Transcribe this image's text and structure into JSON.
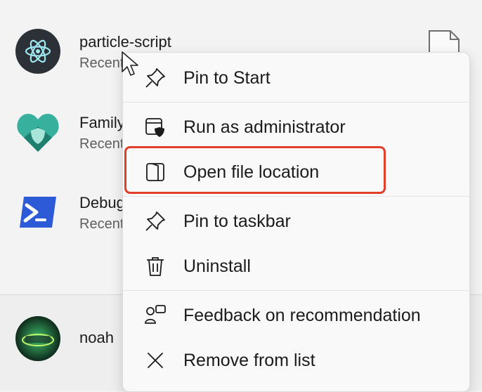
{
  "apps": [
    {
      "name": "particle-script",
      "subtitle": "Recently added",
      "icon": "electron-atom-icon"
    },
    {
      "name": "Family",
      "subtitle": "Recently added",
      "icon": "family-safety-heart-icon"
    },
    {
      "name": "Debug",
      "subtitle": "Recently added",
      "icon": "powershell-icon"
    }
  ],
  "footer": {
    "user_name": "noah",
    "avatar": "user-avatar-icon"
  },
  "context_menu": {
    "items": [
      {
        "label": "Pin to Start",
        "icon": "pin-icon"
      },
      {
        "label": "Run as administrator",
        "icon": "shield-window-icon"
      },
      {
        "label": "Open file location",
        "icon": "folder-open-icon"
      },
      {
        "label": "Pin to taskbar",
        "icon": "pin-icon"
      },
      {
        "label": "Uninstall",
        "icon": "trash-icon"
      },
      {
        "label": "Feedback on recommendation",
        "icon": "feedback-icon"
      },
      {
        "label": "Remove from list",
        "icon": "close-icon"
      }
    ],
    "highlighted_item": "Open file location"
  },
  "colors": {
    "highlight_border": "#e0402a",
    "accent_blue": "#2d5bd7",
    "accent_teal": "#2fa493"
  }
}
